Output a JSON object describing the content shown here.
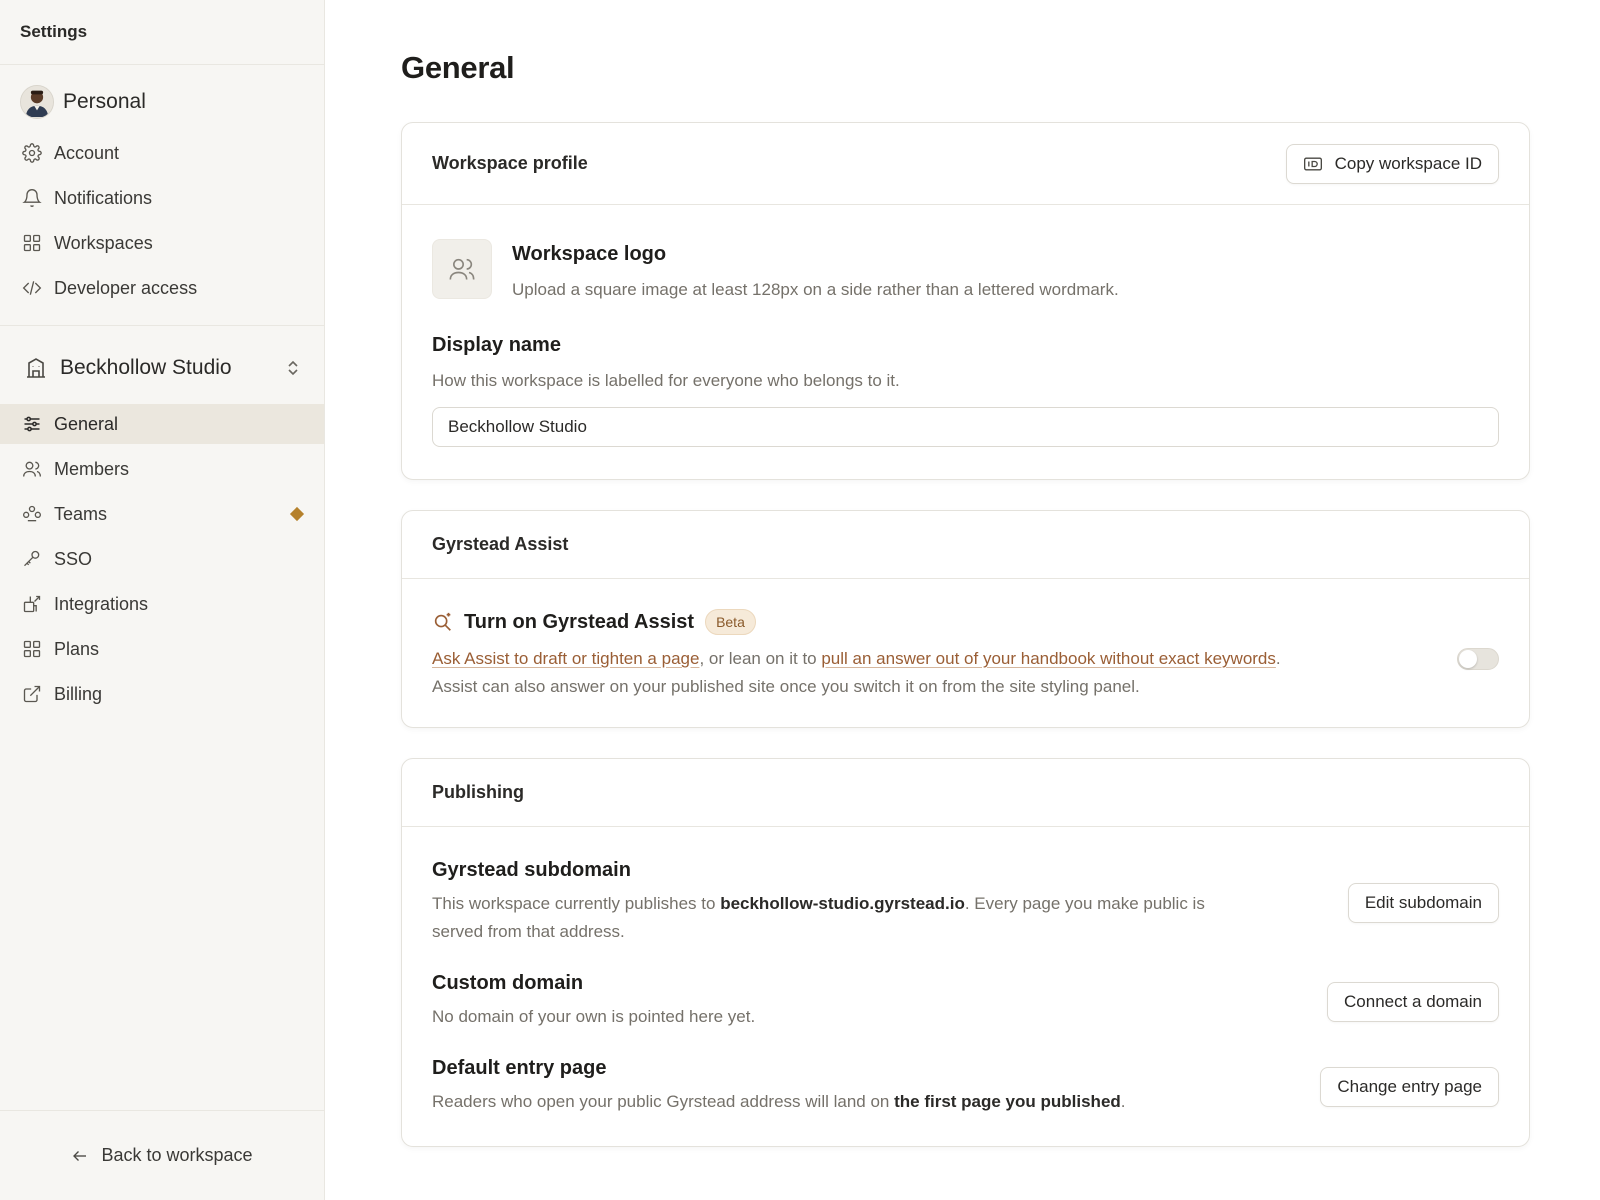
{
  "sidebar": {
    "header": "Settings",
    "profile": {
      "label": "Personal"
    },
    "personal_items": [
      {
        "label": "Account",
        "icon": "gear-icon"
      },
      {
        "label": "Notifications",
        "icon": "bell-icon"
      },
      {
        "label": "Workspaces",
        "icon": "grid-icon"
      },
      {
        "label": "Developer access",
        "icon": "code-icon"
      }
    ],
    "workspace": {
      "label": "Beckhollow Studio"
    },
    "workspace_items": [
      {
        "label": "General",
        "icon": "sliders-icon",
        "active": true
      },
      {
        "label": "Members",
        "icon": "users-icon"
      },
      {
        "label": "Teams",
        "icon": "teams-icon",
        "badge": "diamond"
      },
      {
        "label": "SSO",
        "icon": "key-icon"
      },
      {
        "label": "Integrations",
        "icon": "integrations-icon"
      },
      {
        "label": "Plans",
        "icon": "grid-icon"
      },
      {
        "label": "Billing",
        "icon": "external-link-icon"
      }
    ],
    "back": "Back to workspace"
  },
  "main": {
    "title": "General",
    "profile_card": {
      "title": "Workspace profile",
      "copy_button": "Copy workspace ID",
      "logo_title": "Workspace logo",
      "logo_desc": "Upload a square image at least 128px on a side rather than a lettered wordmark.",
      "display_name_title": "Display name",
      "display_name_desc": "How this workspace is labelled for everyone who belongs to it.",
      "display_name_value": "Beckhollow Studio"
    },
    "assist_card": {
      "title": "Gyrstead Assist",
      "toggle_title": "Turn on Gyrstead Assist",
      "badge": "Beta",
      "link1": "Ask Assist to draft or tighten a page",
      "text1": ", or lean on it to ",
      "link2": "pull an answer out of your handbook without exact keywords",
      "text2": ". Assist can also answer on your published site once you switch it on from the site styling panel.",
      "toggle_on": false
    },
    "publishing_card": {
      "title": "Publishing",
      "subdomain": {
        "title": "Gyrstead subdomain",
        "desc_before": "This workspace currently publishes to ",
        "domain": "beckhollow-studio.gyrstead.io",
        "desc_after": ". Every page you make public is served from that address.",
        "button": "Edit subdomain"
      },
      "custom_domain": {
        "title": "Custom domain",
        "desc": "No domain of your own is pointed here yet.",
        "button": "Connect a domain"
      },
      "entry_page": {
        "title": "Default entry page",
        "desc_before": "Readers who open your public Gyrstead address will land on ",
        "strong": "the first page you published",
        "desc_after": ".",
        "button": "Change entry page"
      }
    }
  },
  "colors": {
    "accent": "#9a5e35",
    "badge_diamond": "#b5812c",
    "sidebar_bg": "#f7f6f3",
    "active_bg": "#ebe7de"
  }
}
